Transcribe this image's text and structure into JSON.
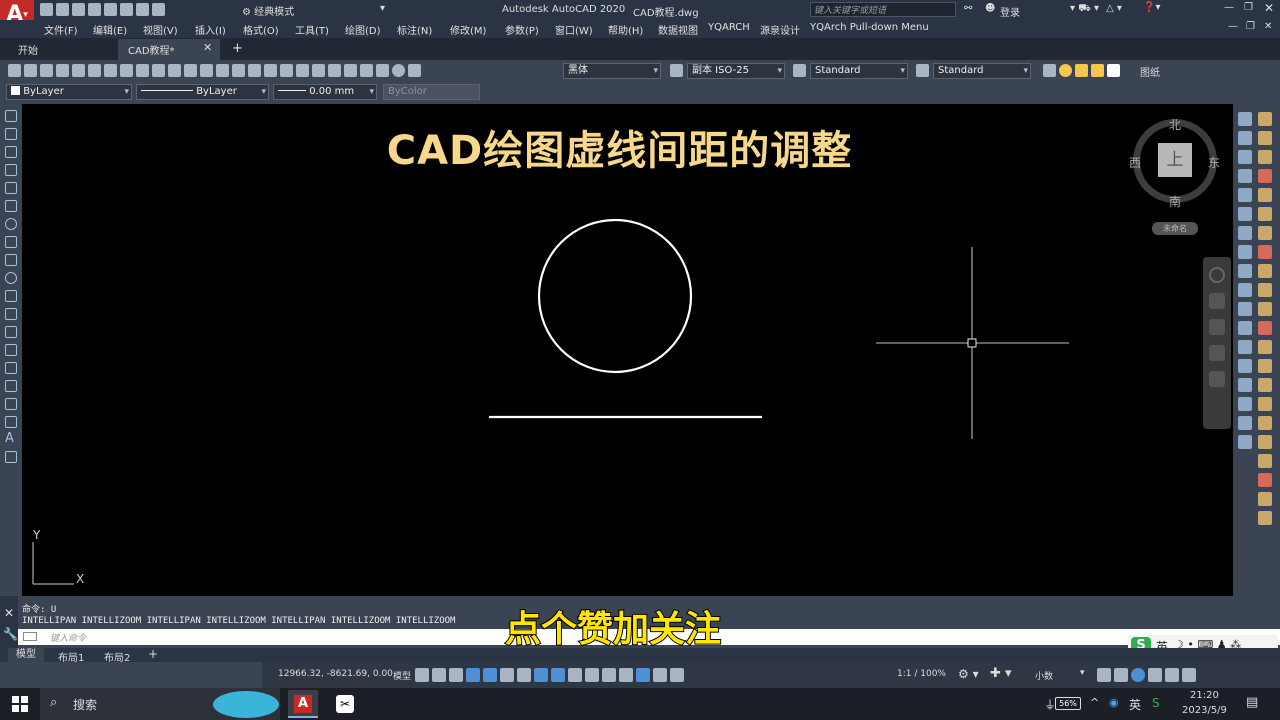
{
  "titlebar": {
    "workspace": "经典模式",
    "app_title": "Autodesk AutoCAD 2020",
    "file_name": "CAD教程.dwg",
    "search_placeholder": "键入关键字或短语",
    "login": "登录"
  },
  "menu": [
    "文件(F)",
    "编辑(E)",
    "视图(V)",
    "插入(I)",
    "格式(O)",
    "工具(T)",
    "绘图(D)",
    "标注(N)",
    "修改(M)",
    "参数(P)",
    "窗口(W)",
    "帮助(H)",
    "数据视图",
    "YQARCH",
    "源泉设计",
    "YQArch Pull-down Menu"
  ],
  "doc_tabs": {
    "start": "开始",
    "active": "CAD教程*",
    "add": "+"
  },
  "toolbar": {
    "font": "黑体",
    "dim_style": "副本 ISO-25",
    "table_style": "Standard",
    "multileader_style": "Standard",
    "layer_name": "图纸"
  },
  "properties": {
    "color": "ByLayer",
    "linetype": "ByLayer",
    "lineweight": "0.00 mm",
    "plot_style": "ByColor"
  },
  "drawing": {
    "title": "CAD绘图虚线间距的调整",
    "ucs_y": "Y",
    "ucs_x": "X"
  },
  "viewcube": {
    "north": "北",
    "south": "南",
    "east": "东",
    "west": "西",
    "top": "上",
    "wcs": "未命名"
  },
  "command": {
    "history_1": "命令:  U",
    "history_2": "INTELLIPAN INTELLIZOOM INTELLIPAN INTELLIZOOM INTELLIPAN INTELLIZOOM INTELLIZOOM",
    "placeholder": "键入命令"
  },
  "subtitle": "点个赞加关注",
  "layout_tabs": [
    "模型",
    "布局1",
    "布局2",
    "+"
  ],
  "status": {
    "coords": "12966.32, -8621.69, 0.00",
    "model": "模型",
    "scale": "1:1 / 100%",
    "units": "小数"
  },
  "ime": {
    "lang": "英"
  },
  "taskbar": {
    "search": "搜索",
    "battery": "56%",
    "ime": "英",
    "time": "21:20",
    "date": "2023/5/9"
  }
}
